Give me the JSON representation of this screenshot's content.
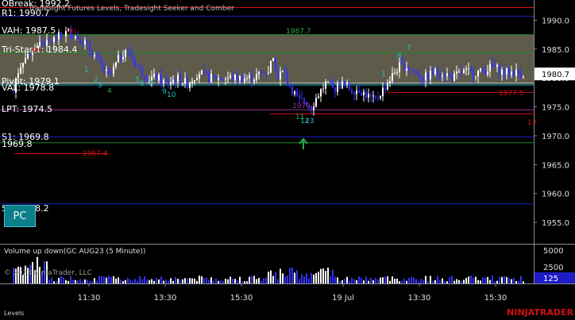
{
  "colors": {
    "background": "#000000",
    "candle": "#ffffff",
    "candle_alt": "#3333ff",
    "value_area": "#5e5b4b",
    "red_line": "#d01010",
    "blue_line": "#1c1cc8",
    "green_line": "#1a8a2c",
    "magenta_line": "#9a2f9a",
    "cyan_line": "#20c0c8",
    "white_line": "#dcdcdc",
    "volume": "#ffffff"
  },
  "chart_data": {
    "type": "candlestick",
    "instrument": "GC AUG23 (5 Minute)",
    "subtitle": "Tradesight Futures Levels, Tradesight Seeker and Comber",
    "price_ylim": [
      1951.3,
      1993.5
    ],
    "price_ticks": [
      "1990.0",
      "1985.0",
      "1980.0",
      "1975.0",
      "1970.0",
      "1965.0",
      "1960.0",
      "1955.0"
    ],
    "last_price": "1980.7",
    "value_area": {
      "low": 1979.0,
      "high": 1987.5
    },
    "levels": [
      {
        "label": "OBreak: 1992.2",
        "price": 1992.2,
        "color": "red"
      },
      {
        "label": "R1: 1990.7",
        "price": 1990.7,
        "color": "blue"
      },
      {
        "label": "VAH: 1987.5",
        "price": 1987.5,
        "color": "green",
        "suffix": "(R)"
      },
      {
        "label": "Tri-Star 1: 1984.4",
        "price": 1984.4,
        "color": "green"
      },
      {
        "label": "Pivot: 1979.1",
        "price": 1979.1,
        "color": "white"
      },
      {
        "label": "VAL: 1978.8",
        "price": 1978.8,
        "color": "cyan"
      },
      {
        "label": "LPT: 1974.5",
        "price": 1974.5,
        "color": "magenta"
      },
      {
        "label": "S1: 1969.8",
        "price": 1969.8,
        "color": "blue"
      },
      {
        "label": "1969.8",
        "price": 1968.8,
        "color": "green"
      },
      {
        "label": "S2: 1958.2",
        "price": 1958.2,
        "color": "blue"
      }
    ],
    "annotations": [
      {
        "text": "1987.7",
        "color": "green"
      },
      {
        "text": "1967.4",
        "color": "red"
      },
      {
        "text": "1977.5",
        "color": "red"
      },
      {
        "text": "1979.1",
        "color": "magenta"
      },
      {
        "text": "13",
        "color": "red"
      },
      {
        "text": "(R)",
        "color": "red"
      }
    ],
    "seeker_labels": [
      "1",
      "2",
      "3",
      "4",
      "5",
      "6",
      "7",
      "8",
      "9",
      "10",
      "11",
      "12",
      "13"
    ],
    "seq_points": [
      {
        "idx": 0,
        "o": 1968,
        "h": 1971,
        "l": 1967,
        "c": 1971
      },
      {
        "idx": 9,
        "o": 1988,
        "h": 1990,
        "l": 1985,
        "c": 1986
      }
    ],
    "x_ticks": [
      "11:30",
      "13:30",
      "15:30",
      "19 Jul",
      "13:30",
      "15:30"
    ],
    "volume": {
      "label": "Volume up down(GC AUG23 (5 Minute))",
      "ticks": [
        "5000",
        "2500"
      ],
      "ylim": [
        0,
        5800
      ],
      "last": "125"
    },
    "copyright": "© 2023 NinjaTrader, LLC",
    "panel_label": "Levels",
    "brand": "NINJATRADER"
  },
  "ui": {
    "pc_button": "PC"
  }
}
